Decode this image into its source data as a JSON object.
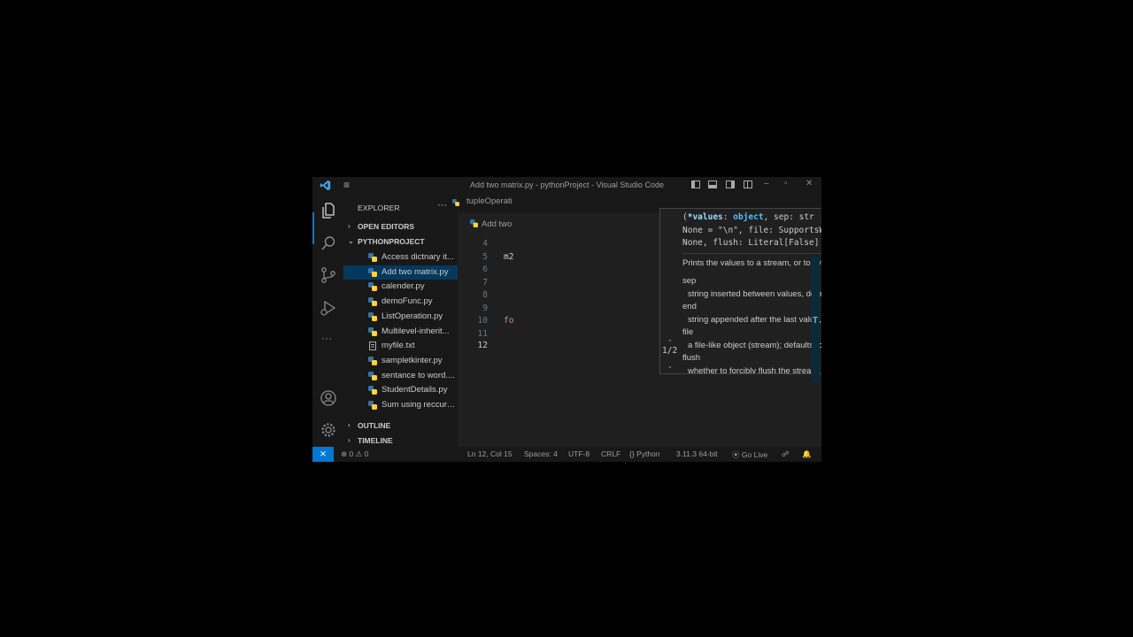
{
  "window": {
    "title": "Add two matrix.py - pythonProject - Visual Studio Code",
    "controls": {
      "minimize": "–",
      "restore": "▫",
      "close": "✕"
    }
  },
  "sidebar": {
    "header": "EXPLORER",
    "more": "···",
    "open_editors": "OPEN EDITORS",
    "project": "PYTHONPROJECT",
    "files": [
      {
        "name": "Access dictnary it...",
        "icon": "python-file-icon"
      },
      {
        "name": "Add two matrix.py",
        "icon": "python-file-icon",
        "selected": true
      },
      {
        "name": "calender.py",
        "icon": "python-file-icon"
      },
      {
        "name": "demoFunc.py",
        "icon": "python-file-icon"
      },
      {
        "name": "ListOperation.py",
        "icon": "python-file-icon"
      },
      {
        "name": "Multilevel-inherit...",
        "icon": "python-file-icon"
      },
      {
        "name": "myfile.txt",
        "icon": "text-file-icon"
      },
      {
        "name": "sampletkinter.py",
        "icon": "python-file-icon"
      },
      {
        "name": "sentance to word....",
        "icon": "python-file-icon"
      },
      {
        "name": "StudentDetails.py",
        "icon": "python-file-icon"
      },
      {
        "name": "Sum using reccurs...",
        "icon": "python-file-icon"
      }
    ],
    "outline": "OUTLINE",
    "timeline": "TIMELINE"
  },
  "editor": {
    "tab_label": "tupleOperati",
    "breadcrumb": "Add two",
    "lines": [
      {
        "num": "4",
        "code": ""
      },
      {
        "num": "5",
        "code": "m2"
      },
      {
        "num": "6",
        "code": ""
      },
      {
        "num": "7",
        "code": ""
      },
      {
        "num": "8",
        "code": ""
      },
      {
        "num": "9",
        "code": ""
      },
      {
        "num": "10",
        "code": "fo"
      },
      {
        "num": "11",
        "code": ""
      },
      {
        "num": "12",
        "code": ""
      }
    ]
  },
  "hover": {
    "sig_open": "(",
    "sig_param": "*values",
    "sig_colon": ": ",
    "sig_ptype": "object",
    "sig_rest1": ", sep: str | None = \" \", end: str |",
    "sig_line2": "None = \"\\n\", file: SupportsWrite[str] | None =",
    "sig_line3": "None, flush: Literal[False] = False) -> None",
    "summary": "Prints the values to a stream, or to sys.stdout by default.",
    "params": [
      {
        "name": "sep",
        "desc": "string inserted between values, default a space."
      },
      {
        "name": "end",
        "desc": "string appended after the last value, default a newline."
      },
      {
        "name": "file",
        "desc": "a file-like object (stream); defaults to the current sys.stdout."
      },
      {
        "name": "flush",
        "desc": "whether to forcibly flush the stream."
      }
    ],
    "pager": "1/2"
  },
  "status": {
    "remote": "⨯",
    "problems": "0",
    "warnings": "0",
    "position": "Ln 12, Col 15",
    "spaces": "Spaces: 4",
    "encoding": "UTF-8",
    "eol": "CRLF",
    "language": "Python",
    "interpreter": "3.11.3 64-bit",
    "golive": "Go Live"
  },
  "colors": {
    "accent": "#0078d4",
    "selection": "#04395e",
    "keyword": "#c586c0",
    "param": "#9cdcfe"
  }
}
